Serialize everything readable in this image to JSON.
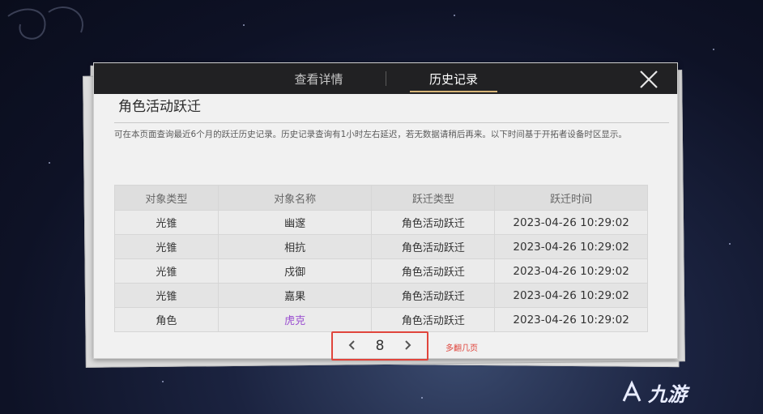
{
  "tabs": {
    "detail_label": "查看详情",
    "history_label": "历史记录"
  },
  "panel": {
    "title": "角色活动跃迁",
    "description": "可在本页面查询最近6个月的跃迁历史记录。历史记录查询有1小时左右延迟，若无数据请稍后再来。以下时间基于开拓者设备时区显示。"
  },
  "table": {
    "headers": [
      "对象类型",
      "对象名称",
      "跃迁类型",
      "跃迁时间"
    ],
    "rows": [
      {
        "type": "光锥",
        "name": "幽邃",
        "warp_type": "角色活动跃迁",
        "time": "2023-04-26 10:29:02"
      },
      {
        "type": "光锥",
        "name": "相抗",
        "warp_type": "角色活动跃迁",
        "time": "2023-04-26 10:29:02"
      },
      {
        "type": "光锥",
        "name": "戍御",
        "warp_type": "角色活动跃迁",
        "time": "2023-04-26 10:29:02"
      },
      {
        "type": "光锥",
        "name": "嘉果",
        "warp_type": "角色活动跃迁",
        "time": "2023-04-26 10:29:02"
      },
      {
        "type": "角色",
        "name": "虎克",
        "warp_type": "角色活动跃迁",
        "time": "2023-04-26 10:29:02"
      }
    ]
  },
  "pager": {
    "prev_icon": "chevron-left-icon",
    "next_icon": "chevron-right-icon",
    "page": "8"
  },
  "annotation": "多翻几页",
  "watermark": "九游",
  "colors": {
    "tab_active_underline": "#d7b679",
    "highlight_purple": "#9b4fd0",
    "annotation_red": "#e0453c"
  }
}
